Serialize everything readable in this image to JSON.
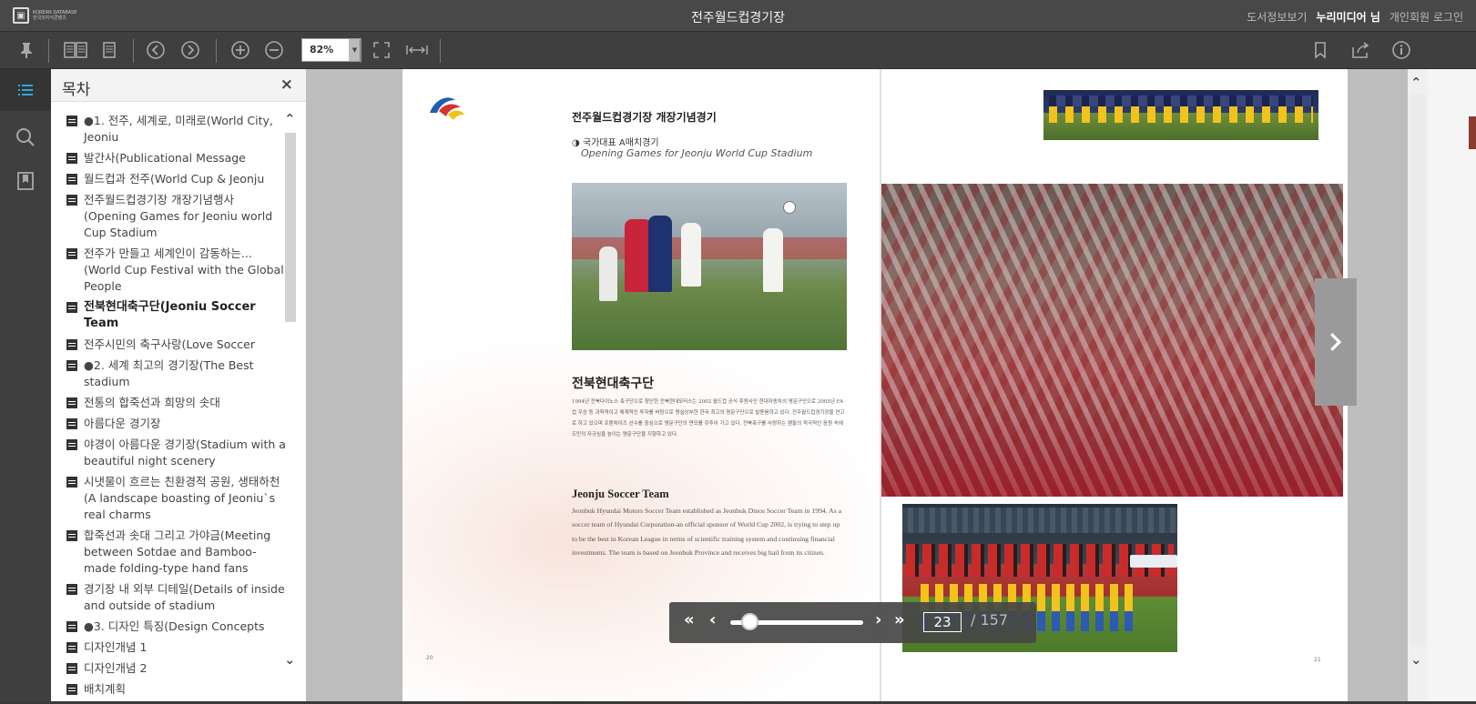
{
  "titlebar": {
    "logo_text_line1": "KOREAN DATABASE",
    "logo_text_line2": "한국의지식콘텐츠",
    "title": "전주월드컵경기장",
    "links": {
      "book_info": "도서정보보기",
      "user_name": "누리미디어 님",
      "login": "개인회원 로그인"
    }
  },
  "toolbar": {
    "zoom_value": "82%",
    "icons": [
      "pin-icon",
      "two-page-icon",
      "single-page-icon",
      "prev-circle-icon",
      "next-circle-icon",
      "zoom-in-icon",
      "zoom-out-icon",
      "fullscreen-icon",
      "fit-width-icon",
      "bookmark-icon",
      "share-icon",
      "info-icon"
    ]
  },
  "rail": {
    "icons": [
      "toc-list-icon",
      "search-icon",
      "bookmark-panel-icon"
    ],
    "active_color": "#2aa8e0"
  },
  "toc": {
    "title": "목차",
    "close": "×",
    "items": [
      {
        "text": "●1. 전주, 세계로, 미래로(World City, Jeoniu",
        "bold": false
      },
      {
        "text": "발간사(Publicational Message",
        "bold": false
      },
      {
        "text": "월드컵과 전주(World Cup & Jeonju",
        "bold": false
      },
      {
        "text": "전주월드컵경기장 개장기념행사(Opening Games for Jeoniu world Cup Stadium",
        "bold": false
      },
      {
        "text": "전주가 만들고 세계인이 감동하는...(World Cup Festival with the Global People",
        "bold": false
      },
      {
        "text": "전북현대축구단(Jeoniu Soccer Team",
        "bold": true
      },
      {
        "text": "전주시민의 축구사랑(Love Soccer",
        "bold": false
      },
      {
        "text": "●2. 세계 최고의 경기장(The Best stadium",
        "bold": false
      },
      {
        "text": "전통의 합죽선과 희망의 솟대",
        "bold": false
      },
      {
        "text": "아름다운 경기장",
        "bold": false
      },
      {
        "text": "야경이 아름다운 경기장(Stadium with a beautiful night scenery",
        "bold": false
      },
      {
        "text": "시냇물이 흐르는 친환경적 공원, 생태하천(A landscape boasting of Jeoniu`s real charms",
        "bold": false
      },
      {
        "text": "합죽선과 솟대 그리고 가야금(Meeting between Sotdae and Bamboo-made folding-type hand fans",
        "bold": false
      },
      {
        "text": "경기장 내 외부 디테일(Details of inside and outside of stadium",
        "bold": false
      },
      {
        "text": "●3. 디자인 특징(Design Concepts",
        "bold": false
      },
      {
        "text": "디자인개념 1",
        "bold": false
      },
      {
        "text": "디자인개념 2",
        "bold": false
      },
      {
        "text": "배치계획",
        "bold": false
      }
    ]
  },
  "page_left": {
    "heading": "전주월드컵경기장 개장기념경기",
    "subheading": "◑ 국가대표 A매치경기",
    "subheading_en": "Opening Games for Jeonju World Cup Stadium",
    "section1_title": "전북현대축구단",
    "section1_body": "1994년 전북다이노스 축구단으로 창단한 전북현대모터스는 2002 월드컵 공식 후원사인 현대자동차의 명문구단으로 2005년 FA컵 우승 등 과학적이고 체계적인 투자를 바탕으로 명실상부한 한국 최고의 명문구단으로 발돋움하고 있다. 전주월드컵경기장을 연고로 하고 있으며 프랜차이즈 선수를 중심으로 명문구단의 면모를 갖추어 가고 있다. 전북축구를 사랑하는 팬들의 적극적인 응원 속에 도민의 자긍심을 높이는 명문구단을 지향하고 있다.",
    "section2_title": "Jeonju Soccer Team",
    "section2_body": "Jeonbuk Hyundai Motors Soccer Team established as Jeonbuk Dinos Soccer Team in 1994. As a soccer team of Hyundai Corporation-an official sponsor of World Cup 2002, is trying to step up to be the best in Korean League in terms of scientific training system and continuing financial investments. The team is based on Jeonbuk Province and receives big hail from its citizen.",
    "page_number": "20"
  },
  "page_right": {
    "page_number": "21"
  },
  "pager": {
    "first": "«",
    "prev": "‹",
    "next": "›",
    "last": "»",
    "current_page": "23",
    "total_pages": "/ 157",
    "progress_fraction": 0.146
  }
}
